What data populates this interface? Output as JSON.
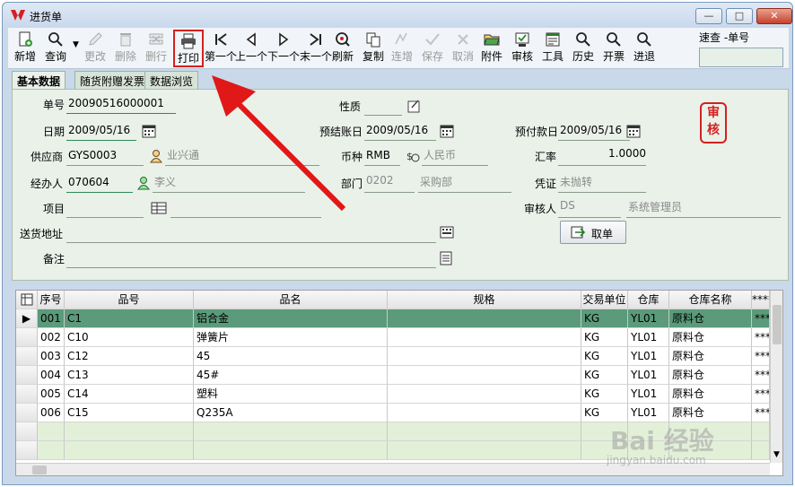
{
  "window": {
    "title": "进货单",
    "minimize": "—",
    "maximize": "□",
    "close": "✕"
  },
  "toolbar": [
    {
      "name": "new-button",
      "label": "新增",
      "icon": "new-doc-icon",
      "disabled": false
    },
    {
      "name": "query-button",
      "label": "查询",
      "icon": "search-icon",
      "disabled": false
    },
    {
      "name": "edit-button",
      "label": "更改",
      "icon": "pencil-icon",
      "disabled": true
    },
    {
      "name": "delete-button",
      "label": "删除",
      "icon": "trash-icon",
      "disabled": true
    },
    {
      "name": "delete-row-button",
      "label": "删行",
      "icon": "delete-row-icon",
      "disabled": true
    },
    {
      "name": "print-button",
      "label": "打印",
      "icon": "printer-icon",
      "disabled": false
    },
    {
      "name": "first-button",
      "label": "第一个",
      "icon": "first-icon",
      "disabled": false
    },
    {
      "name": "prev-button",
      "label": "上一个",
      "icon": "prev-icon",
      "disabled": false
    },
    {
      "name": "next-button",
      "label": "下一个",
      "icon": "next-icon",
      "disabled": false
    },
    {
      "name": "last-button",
      "label": "末一个",
      "icon": "last-icon",
      "disabled": false
    },
    {
      "name": "refresh-button",
      "label": "刷新",
      "icon": "refresh-icon",
      "disabled": false
    },
    {
      "name": "copy-button",
      "label": "复制",
      "icon": "copy-icon",
      "disabled": false
    },
    {
      "name": "batch-add-button",
      "label": "连增",
      "icon": "batch-add-icon",
      "disabled": true
    },
    {
      "name": "save-button",
      "label": "保存",
      "icon": "check-icon",
      "disabled": true
    },
    {
      "name": "cancel-button",
      "label": "取消",
      "icon": "x-icon",
      "disabled": true
    },
    {
      "name": "attachment-button",
      "label": "附件",
      "icon": "folder-icon",
      "disabled": false
    },
    {
      "name": "audit-button",
      "label": "审核",
      "icon": "audit-icon",
      "disabled": false
    },
    {
      "name": "tools-button",
      "label": "工具",
      "icon": "tools-icon",
      "disabled": false
    },
    {
      "name": "history-button",
      "label": "历史",
      "icon": "search-icon",
      "disabled": false
    },
    {
      "name": "invoice-button",
      "label": "开票",
      "icon": "search-icon",
      "disabled": false
    },
    {
      "name": "purchase-return-button",
      "label": "进退",
      "icon": "search-icon",
      "disabled": false
    }
  ],
  "quick_search": {
    "label": "速查  -单号",
    "value": ""
  },
  "tabs": [
    "基本数据",
    "随货附赠发票",
    "数据浏览"
  ],
  "form": {
    "order_no_label": "单号",
    "order_no": "20090516000001",
    "nature_label": "性质",
    "nature": "",
    "date_label": "日期",
    "date": "2009/05/16",
    "due_date_label": "预结账日",
    "due_date": "2009/05/16",
    "prepay_date_label": "预付款日",
    "prepay_date": "2009/05/16",
    "supplier_label": "供应商",
    "supplier_code": "GYS0003",
    "supplier_name": "业兴通",
    "currency_label": "币种",
    "currency_code": "RMB",
    "currency_name": "人民币",
    "rate_label": "汇率",
    "rate": "1.0000",
    "handler_label": "经办人",
    "handler_code": "070604",
    "handler_name": "李义",
    "dept_label": "部门",
    "dept_code": "0202",
    "dept_name": "采购部",
    "voucher_label": "凭证",
    "voucher": "未抛转",
    "project_label": "项目",
    "project": "",
    "auditor_label": "审核人",
    "auditor_code": "DS",
    "auditor_name": "系统管理员",
    "address_label": "送货地址",
    "address": "",
    "remark_label": "备注",
    "remark": "",
    "stamp": "审核",
    "cancel_order_label": "取单"
  },
  "grid": {
    "columns": [
      "序号",
      "品号",
      "品名",
      "规格",
      "交易单位",
      "仓库",
      "仓库名称",
      "****"
    ],
    "rows": [
      [
        "001",
        "C1",
        "铝合金",
        "",
        "KG",
        "YL01",
        "原料仓",
        "****"
      ],
      [
        "002",
        "C10",
        "弹簧片",
        "",
        "KG",
        "YL01",
        "原料仓",
        "****"
      ],
      [
        "003",
        "C12",
        "45",
        "",
        "KG",
        "YL01",
        "原料仓",
        "****"
      ],
      [
        "004",
        "C13",
        "45#",
        "",
        "KG",
        "YL01",
        "原料仓",
        "****"
      ],
      [
        "005",
        "C14",
        "塑料",
        "",
        "KG",
        "YL01",
        "原料仓",
        "****"
      ],
      [
        "006",
        "C15",
        "Q235A",
        "",
        "KG",
        "YL01",
        "原料仓",
        "****"
      ]
    ]
  },
  "watermark": {
    "main": "Bai 经验",
    "sub": "jingyan.baidu.com"
  },
  "colors": {
    "accent_red": "#d42020",
    "selected_row": "#5b9a7a",
    "panel": "#e9f1e9"
  }
}
